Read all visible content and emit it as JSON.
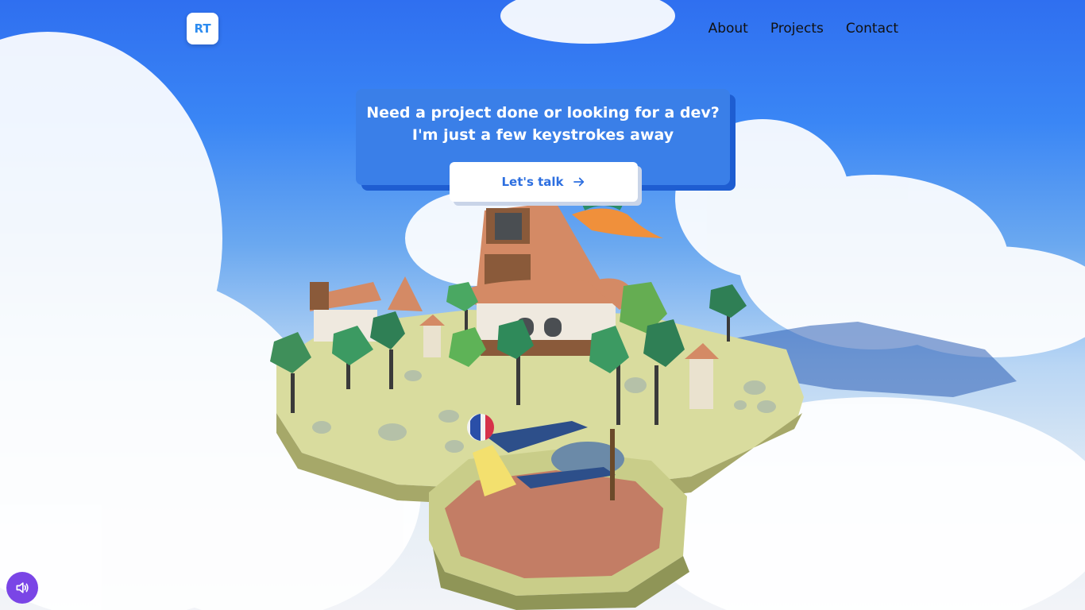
{
  "header": {
    "logo_text": "RT",
    "nav": [
      {
        "label": "About"
      },
      {
        "label": "Projects"
      },
      {
        "label": "Contact"
      }
    ]
  },
  "hero": {
    "line1": "Need a project done or looking for a dev?",
    "line2": "I'm just a few keystrokes away",
    "cta_label": "Let's talk",
    "cta_icon": "arrow-right-icon"
  },
  "controls": {
    "sound_icon": "speaker-icon"
  },
  "colors": {
    "accent": "#3a7fe8",
    "accent_dark": "#1e5dd1",
    "sound_button": "#7a45e6"
  }
}
